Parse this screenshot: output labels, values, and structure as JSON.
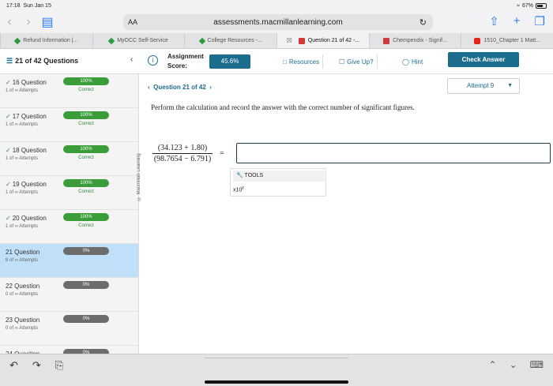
{
  "status": {
    "time": "17:18",
    "date": "Sun Jan 15",
    "battery": "67%",
    "battery_level": 0.67
  },
  "browser": {
    "text_size": "AA",
    "url": "assessments.macmillanlearning.com",
    "tabs": [
      {
        "label": "Refund Information |...",
        "fav": "green"
      },
      {
        "label": "MyOCC Self-Service",
        "fav": "green"
      },
      {
        "label": "College Resources -...",
        "fav": "green"
      },
      {
        "label": "Question 21 of 42 -...",
        "fav": "red",
        "active": true
      },
      {
        "label": "Chempendix - Signif...",
        "fav": "red"
      },
      {
        "label": "1510_Chapter 1 Matt...",
        "fav": "yt"
      }
    ]
  },
  "header": {
    "question_count": "21 of 42 Questions",
    "score_label": "Assignment Score:",
    "score_value": "45.6%",
    "resources": "Resources",
    "give_up": "Give Up?",
    "hint": "Hint",
    "check_answer": "Check Answer"
  },
  "sidebar": {
    "items": [
      {
        "title": "16 Question",
        "attempts": "1 of ∞ Attempts",
        "pct": "100%",
        "status": "Correct",
        "done": true
      },
      {
        "title": "17 Question",
        "attempts": "1 of ∞ Attempts",
        "pct": "100%",
        "status": "Correct",
        "done": true
      },
      {
        "title": "18 Question",
        "attempts": "1 of ∞ Attempts",
        "pct": "100%",
        "status": "Correct",
        "done": true
      },
      {
        "title": "19 Question",
        "attempts": "1 of ∞ Attempts",
        "pct": "100%",
        "status": "Correct",
        "done": true
      },
      {
        "title": "20 Question",
        "attempts": "1 of ∞ Attempts",
        "pct": "100%",
        "status": "Correct",
        "done": true
      },
      {
        "title": "21 Question",
        "attempts": "8 of ∞ Attempts",
        "pct": "0%",
        "status": "",
        "active": true
      },
      {
        "title": "22 Question",
        "attempts": "0 of ∞ Attempts",
        "pct": "0%",
        "status": ""
      },
      {
        "title": "23 Question",
        "attempts": "0 of ∞ Attempts",
        "pct": "0%",
        "status": ""
      },
      {
        "title": "24 Question",
        "attempts": "",
        "pct": "0%",
        "status": ""
      }
    ]
  },
  "question": {
    "nav": "Question 21 of 42",
    "attempt": "Attempt 9",
    "copyright": "© Macmillan Learning",
    "prompt": "Perform the calculation and record the answer with the correct number of significant figures.",
    "numerator": "(34.123 + 1.80)",
    "denominator": "(98.7654 − 6.791)",
    "equals": "=",
    "answer_value": "",
    "tools_label": "TOOLS",
    "x10_base": "x10",
    "x10_exp": "y"
  }
}
